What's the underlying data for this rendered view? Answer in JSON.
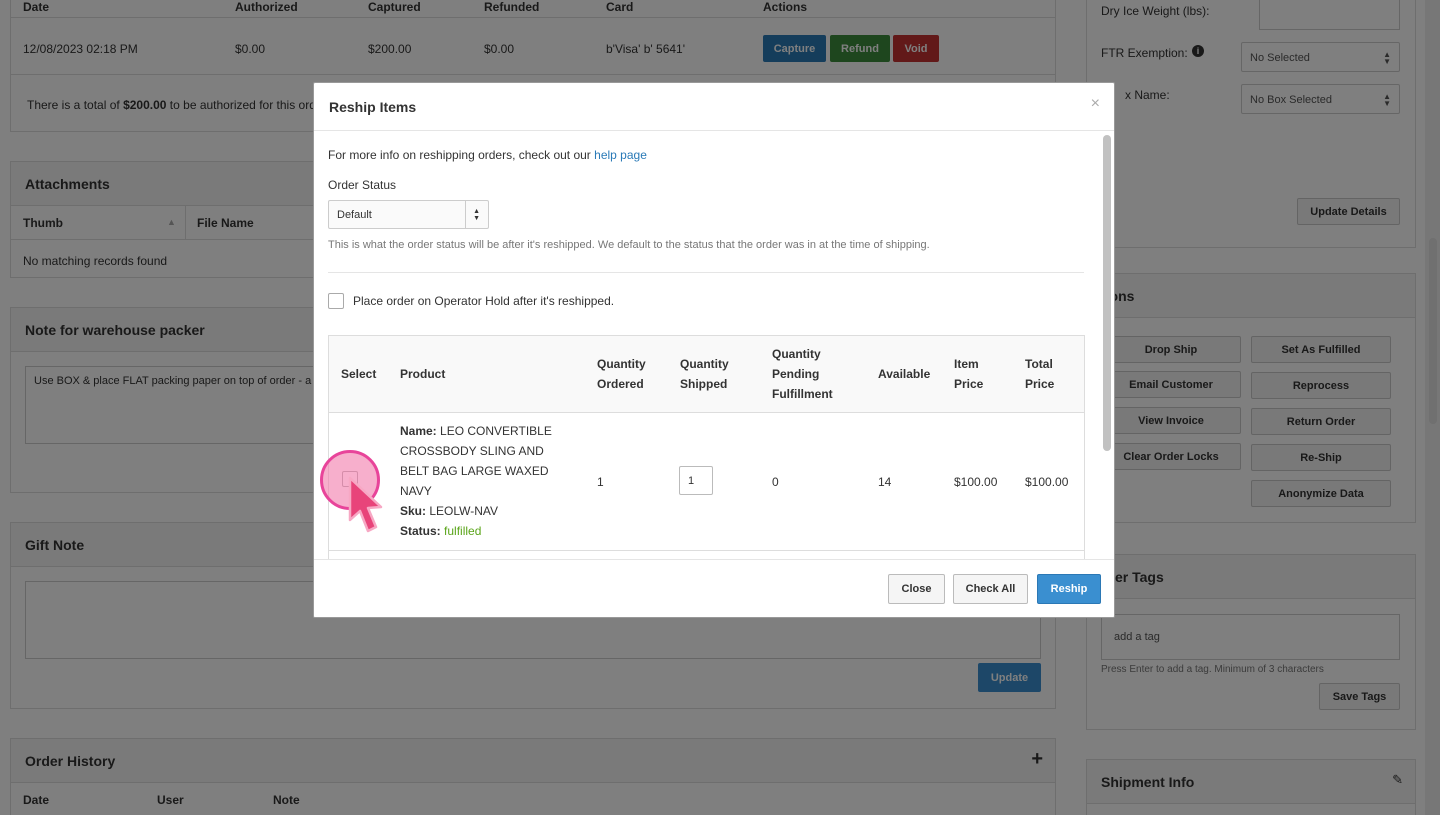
{
  "payments": {
    "headers": [
      "Date",
      "Authorized",
      "Captured",
      "Refunded",
      "Card",
      "Actions"
    ],
    "row": {
      "date": "12/08/2023 02:18 PM",
      "authorized": "$0.00",
      "captured": "$200.00",
      "refunded": "$0.00",
      "card": "b'Visa' b' 5641'"
    },
    "actions": {
      "capture": "Capture",
      "refund": "Refund",
      "void": "Void"
    },
    "total_prefix": "There is a total of",
    "total_amount": "$200.00",
    "total_suffix": "to be authorized for this ord"
  },
  "attachments": {
    "title": "Attachments",
    "col_thumb": "Thumb",
    "col_filename": "File Name",
    "empty": "No matching records found"
  },
  "warehouse_note": {
    "title": "Note for warehouse packer",
    "text": "Use BOX & place FLAT packing paper on top of order - a"
  },
  "gift_note": {
    "title": "Gift Note",
    "update_label": "Update"
  },
  "order_history": {
    "title": "Order History",
    "add_symbol": "+",
    "col_date": "Date",
    "col_user": "User",
    "col_note": "Note"
  },
  "side_details": {
    "dry_ice_label": "Dry Ice Weight (lbs):",
    "ftr_label": "FTR Exemption:",
    "ftr_value": "No Selected",
    "box_label": "x Name:",
    "box_value": "No Box Selected",
    "update_details": "Update Details"
  },
  "side_actions": {
    "title": "tions",
    "left": [
      "Drop Ship",
      "Email Customer",
      "View Invoice",
      "Clear Order Locks"
    ],
    "right": [
      "Set As Fulfilled",
      "Reprocess",
      "Return Order",
      "Re-Ship",
      "Anonymize Data"
    ]
  },
  "side_tags": {
    "title": "rder Tags",
    "placeholder": "add a tag",
    "hint": "Press Enter to add a tag. Minimum of 3 characters",
    "save_label": "Save Tags"
  },
  "shipment_info": {
    "title": "Shipment Info"
  },
  "modal": {
    "title": "Reship Items",
    "close_symbol": "×",
    "info_text": "For more info on reshipping orders, check out our",
    "info_link": "help page",
    "order_status_label": "Order Status",
    "order_status_value": "Default",
    "order_status_help": "This is what the order status will be after it's reshipped. We default to the status that the order was in at the time of shipping.",
    "hold_label": "Place order on Operator Hold after it's reshipped.",
    "table": {
      "headers": {
        "select": "Select",
        "product": "Product",
        "qty_ordered_1": "Quantity",
        "qty_ordered_2": "Ordered",
        "qty_shipped_1": "Quantity",
        "qty_shipped_2": "Shipped",
        "qty_pending_1": "Quantity",
        "qty_pending_2": "Pending",
        "qty_pending_3": "Fulfillment",
        "available": "Available",
        "item_price_1": "Item",
        "item_price_2": "Price",
        "total_price_1": "Total",
        "total_price_2": "Price"
      },
      "rows": [
        {
          "name_label": "Name:",
          "name": "LEO CONVERTIBLE CROSSBODY SLING AND BELT BAG LARGE WAXED NAVY",
          "sku_label": "Sku:",
          "sku": "LEOLW-NAV",
          "status_label": "Status:",
          "status": "fulfilled",
          "qty_ordered": "1",
          "qty_shipped": "1",
          "qty_pending": "0",
          "available": "14",
          "item_price": "$100.00",
          "total_price": "$100.00"
        }
      ]
    },
    "buttons": {
      "close": "Close",
      "check_all": "Check All",
      "reship": "Reship"
    }
  },
  "colors": {
    "capture": "#2a7ab7",
    "refund": "#3c8d3c",
    "void": "#c43333",
    "primary": "#3a8fd0",
    "link": "#2a7ab7",
    "status_fulfilled": "#5aa519",
    "cursor_ring": "#e8449a"
  }
}
